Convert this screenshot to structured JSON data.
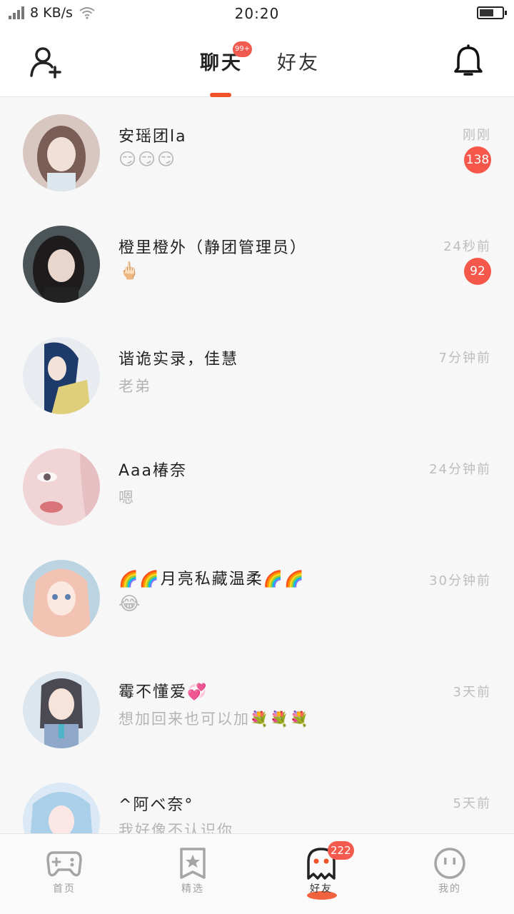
{
  "status_bar": {
    "net_speed": "8 KB/s",
    "time": "20:20"
  },
  "header": {
    "tabs": [
      {
        "label": "聊天",
        "badge": "99+",
        "active": true
      },
      {
        "label": "好友",
        "active": false
      }
    ]
  },
  "conversations": [
    {
      "name": "安瑶团la",
      "message": "😏😏😏",
      "time": "刚刚",
      "unread": "138",
      "avatar_colors": [
        "#d8c6c0",
        "#7a5d55"
      ]
    },
    {
      "name": "橙里橙外（静团管理员）",
      "message": "🖕🏻",
      "time": "24秒前",
      "unread": "92",
      "avatar_colors": [
        "#4b5558",
        "#d9c7bd"
      ]
    },
    {
      "name": "谐诡实录，佳慧",
      "message": "老弟",
      "time": "7分钟前",
      "unread": "",
      "avatar_colors": [
        "#e8ecf0",
        "#1d3a6b"
      ]
    },
    {
      "name": "Aaa椿奈",
      "message": "嗯",
      "time": "24分钟前",
      "unread": "",
      "avatar_colors": [
        "#f1d4d6",
        "#c98f94"
      ]
    },
    {
      "name": "🌈🌈月亮私藏温柔🌈🌈",
      "message": "😂",
      "time": "30分钟前",
      "unread": "",
      "avatar_colors": [
        "#bcd4e2",
        "#f2c3b2"
      ]
    },
    {
      "name": "霉不懂爱💞",
      "message": "想加回来也可以加💐💐💐",
      "time": "3天前",
      "unread": "",
      "avatar_colors": [
        "#dce6ef",
        "#4b4a52"
      ]
    },
    {
      "name": "^阿ベ奈°",
      "message": "我好像不认识你",
      "time": "5天前",
      "unread": "",
      "avatar_colors": [
        "#dbe8f6",
        "#f3c6d4"
      ]
    }
  ],
  "bottom_nav": [
    {
      "label": "首页",
      "icon": "gamepad-icon",
      "badge": ""
    },
    {
      "label": "精选",
      "icon": "star-icon",
      "badge": ""
    },
    {
      "label": "好友",
      "icon": "ghost-icon",
      "badge": "222",
      "active": true
    },
    {
      "label": "我的",
      "icon": "face-icon",
      "badge": ""
    }
  ],
  "colors": {
    "accent": "#f0522a",
    "badge": "#f5574a"
  }
}
